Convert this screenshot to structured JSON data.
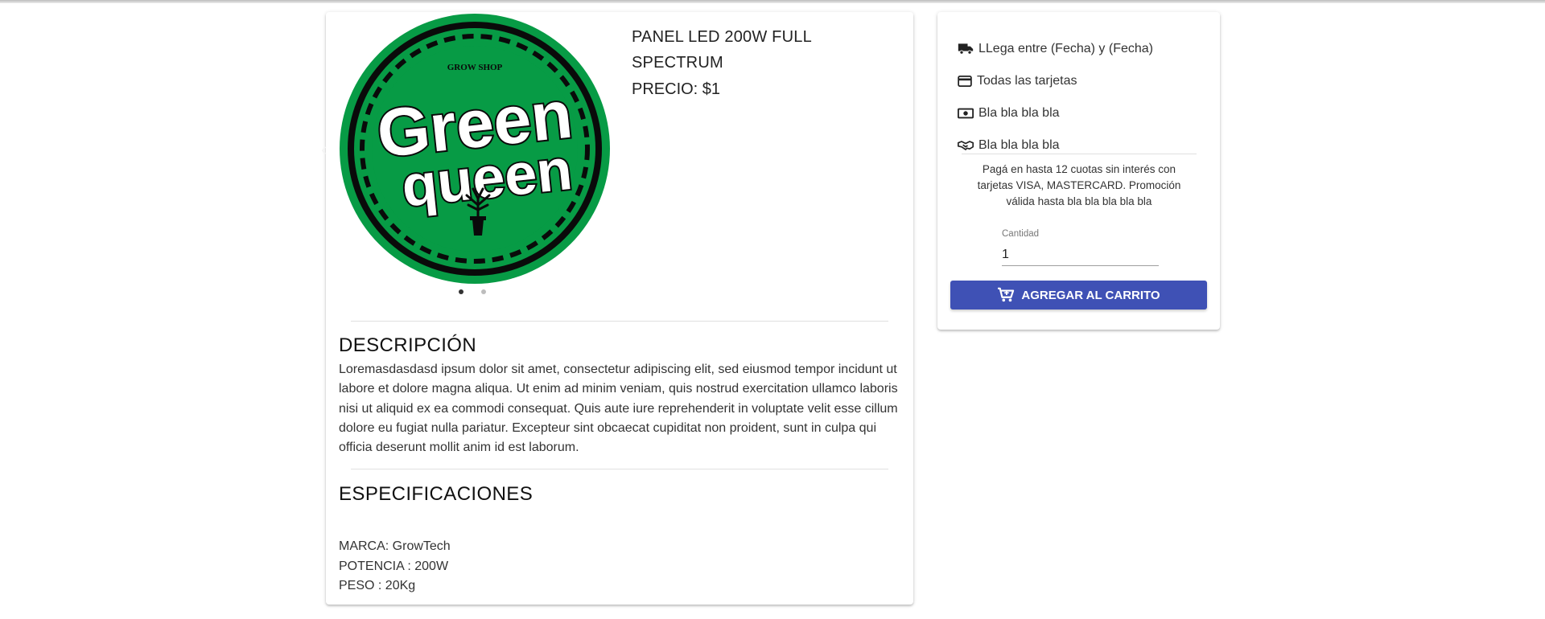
{
  "product": {
    "title": "PANEL LED 200W FULL SPECTRUM",
    "price": "PRECIO: $1",
    "logo": {
      "top_text": "GROW SHOP",
      "line1": "Green",
      "line2": "queen",
      "icon": "plant-pot-icon",
      "colors": {
        "green": "#079b45",
        "black": "#0a0a0a",
        "white": "#ffffff"
      }
    },
    "carousel": {
      "slides": 2,
      "active": 1
    },
    "description": {
      "title": "DESCRIPCIÓN",
      "text": "Loremasdasdasd ipsum dolor sit amet, consectetur adipiscing elit, sed eiusmod tempor incidunt ut labore et dolore magna aliqua. Ut enim ad minim veniam, quis nostrud exercitation ullamco laboris nisi ut aliquid ex ea commodi consequat. Quis aute iure reprehenderit in voluptate velit esse cillum dolore eu fugiat nulla pariatur. Excepteur sint obcaecat cupiditat non proident, sunt in culpa qui officia deserunt mollit anim id est laborum."
    },
    "specs": {
      "title": "ESPECIFICACIONES",
      "items": [
        "MARCA: GrowTech",
        "POTENCIA : 200W",
        "PESO : 20Kg"
      ]
    }
  },
  "purchase": {
    "rows": [
      {
        "icon": "truck-icon",
        "text": "LLega entre (Fecha) y (Fecha)"
      },
      {
        "icon": "credit-card-icon",
        "text": "Todas las tarjetas"
      },
      {
        "icon": "money-icon",
        "text": "Bla bla bla bla"
      },
      {
        "icon": "handshake-icon",
        "text": "Bla bla bla bla"
      }
    ],
    "promo": "Pagá en hasta 12 cuotas sin interés con tarjetas VISA, MASTERCARD. Promoción válida hasta bla bla bla bla bla",
    "quantity_label": "Cantidad",
    "quantity_value": "1",
    "add_button": "AGREGAR AL CARRITO",
    "accent": "#3f51b5"
  }
}
